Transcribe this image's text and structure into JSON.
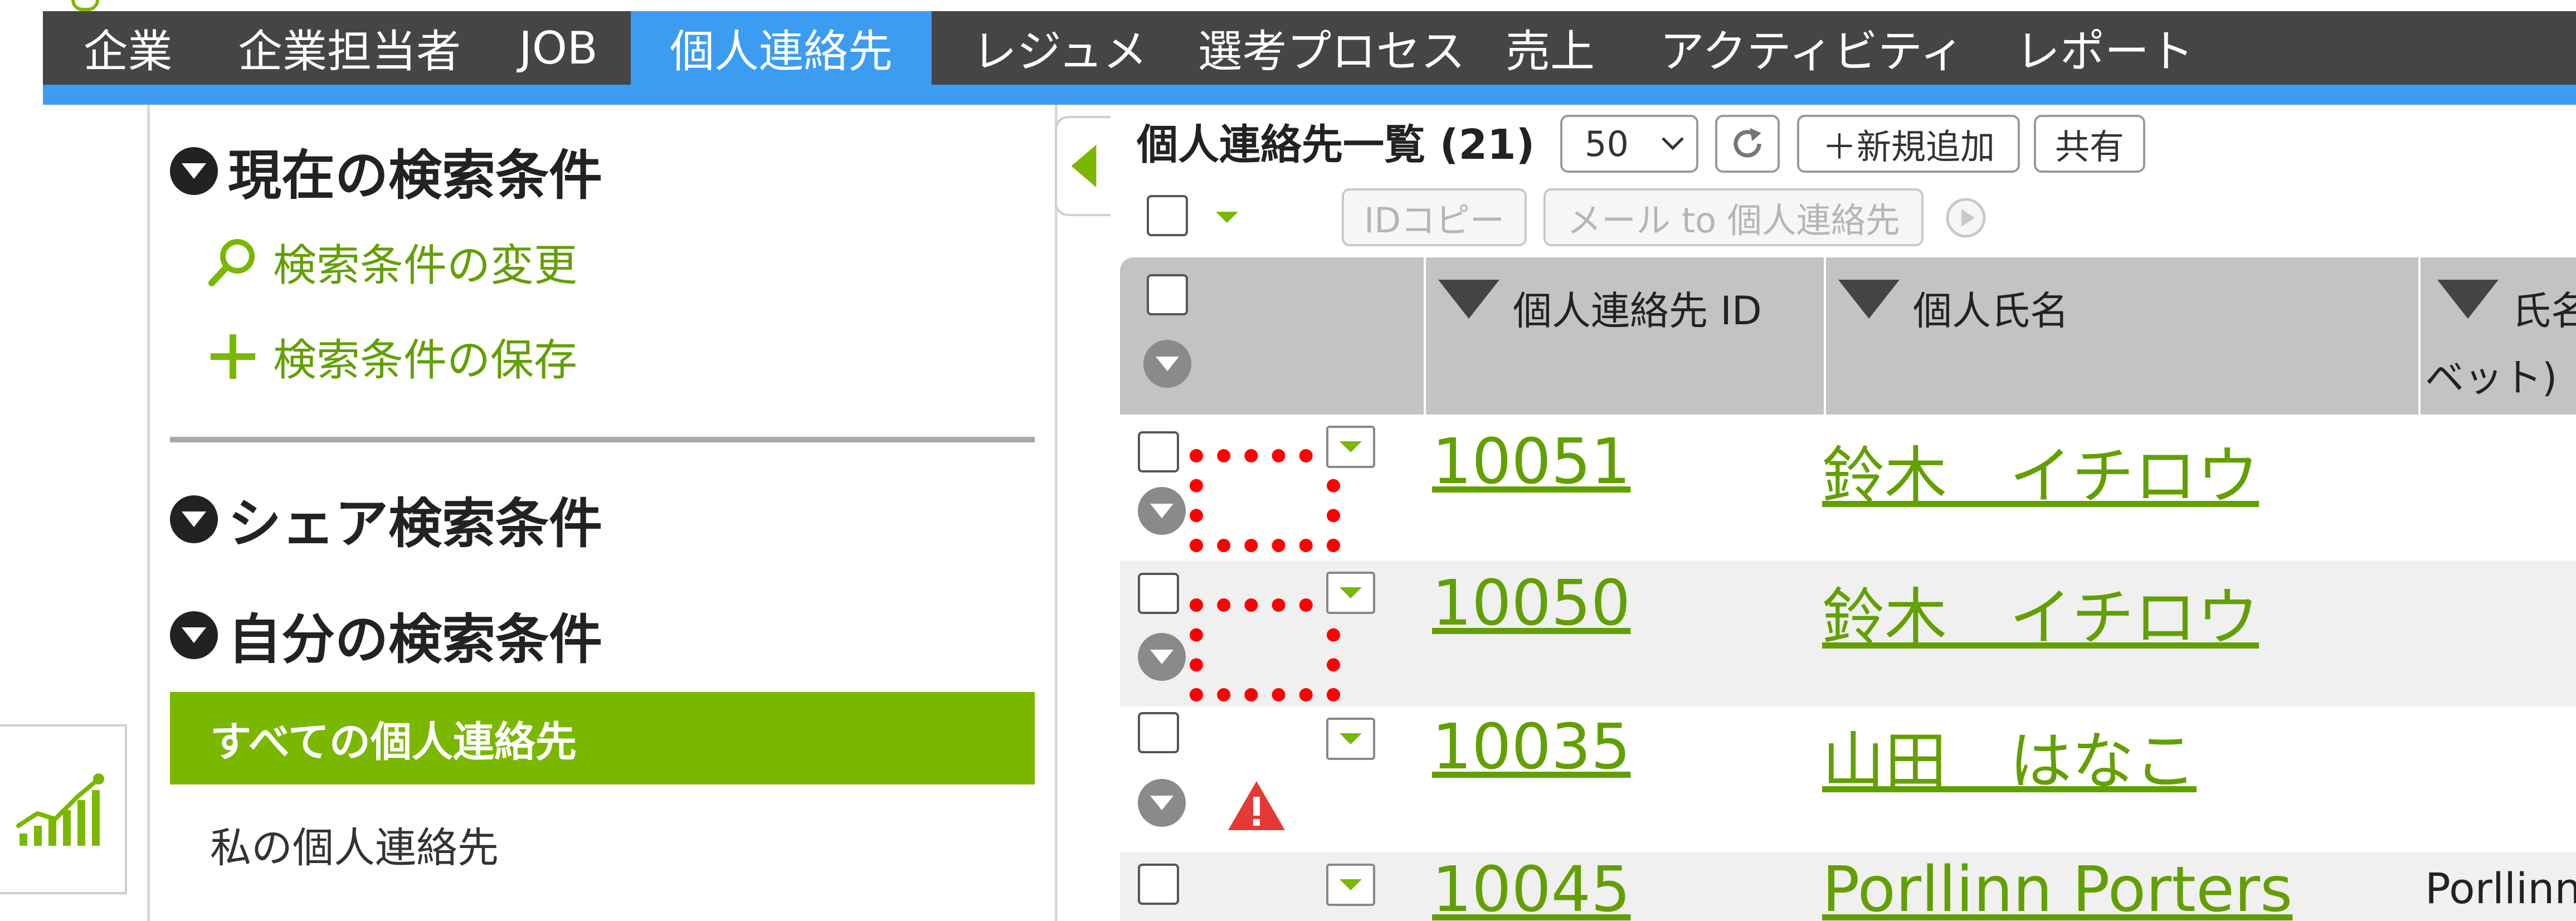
{
  "nav": {
    "items": [
      {
        "label": "企業",
        "active": false
      },
      {
        "label": "企業担当者",
        "active": false
      },
      {
        "label": "JOB",
        "active": false
      },
      {
        "label": "個人連絡先",
        "active": true
      },
      {
        "label": "レジュメ",
        "active": false
      },
      {
        "label": "選考プロセス",
        "active": false
      },
      {
        "label": "売上",
        "active": false
      },
      {
        "label": "アクティビティ",
        "active": false
      },
      {
        "label": "レポート",
        "active": false
      }
    ]
  },
  "sidebar": {
    "current_conditions_title": "現在の検索条件",
    "change_conditions_label": "検索条件の変更",
    "save_conditions_label": "検索条件の保存",
    "shared_conditions_title": "シェア検索条件",
    "my_conditions_title": "自分の検索条件",
    "folders": [
      {
        "label": "すべての個人連絡先",
        "selected": true
      },
      {
        "label": "私の個人連絡先",
        "selected": false
      }
    ]
  },
  "list": {
    "title": "個人連絡先一覧 (21)",
    "per_page": "50",
    "add_label": "＋新規追加",
    "share_label": "共有",
    "id_copy_label": "IDコピー",
    "mail_label": "メール to 個人連絡先"
  },
  "table": {
    "columns": [
      "個人連絡先 ID",
      "個人氏名",
      "氏名",
      "ベット)"
    ],
    "rows": [
      {
        "id": "10051",
        "name": "鈴木　イチロウ",
        "alpha": "",
        "photo_placeholder": true,
        "warning": false
      },
      {
        "id": "10050",
        "name": "鈴木　イチロウ",
        "alpha": "",
        "photo_placeholder": true,
        "warning": false
      },
      {
        "id": "10035",
        "name": "山田　はなこ",
        "alpha": "",
        "photo_placeholder": false,
        "warning": true
      },
      {
        "id": "10045",
        "name": "Porllinn Porters",
        "alpha": "Porllinn",
        "photo_placeholder": false,
        "warning": false
      }
    ]
  },
  "icons": {
    "section_toggle": "chevron-down-circle-icon",
    "change": "search-icon",
    "save": "plus-icon",
    "refresh": "refresh-icon",
    "collapse": "triangle-left-icon",
    "widget": "chart-growth-icon",
    "warning": "warning-icon",
    "play": "play-circle-icon"
  },
  "colors": {
    "nav_bg": "#454545",
    "nav_active": "#3b9cf2",
    "accent_green": "#7ab800",
    "link_green": "#62a000",
    "placeholder_red": "#ff0000",
    "warning_red": "#e53935"
  }
}
